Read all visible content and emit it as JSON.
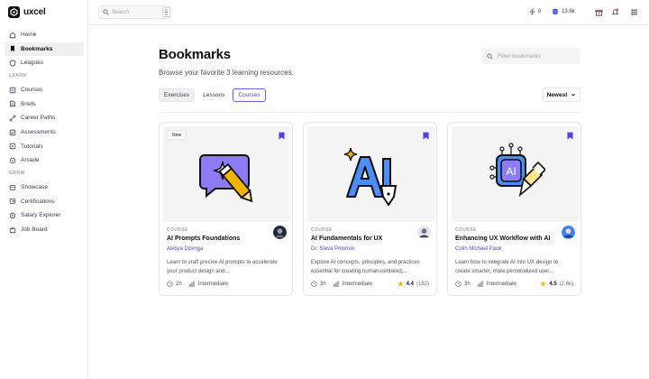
{
  "app": {
    "name": "uxcel"
  },
  "sidebar": {
    "items": [
      {
        "label": "Home",
        "icon": "home-icon"
      },
      {
        "label": "Bookmarks",
        "icon": "bookmark-icon",
        "active": true
      },
      {
        "label": "Leagues",
        "icon": "shield-icon"
      }
    ],
    "learn_title": "LEARN",
    "learn_items": [
      {
        "label": "Courses",
        "icon": "courses-icon"
      },
      {
        "label": "Briefs",
        "icon": "briefs-icon"
      },
      {
        "label": "Career Paths",
        "icon": "career-paths-icon"
      },
      {
        "label": "Assessments",
        "icon": "assessments-icon"
      },
      {
        "label": "Tutorials",
        "icon": "tutorials-icon"
      },
      {
        "label": "Arcade",
        "icon": "arcade-icon"
      }
    ],
    "grow_title": "GROW",
    "grow_items": [
      {
        "label": "Showcase",
        "icon": "showcase-icon"
      },
      {
        "label": "Certifications",
        "icon": "certifications-icon"
      },
      {
        "label": "Salary Explorer",
        "icon": "salary-explorer-icon"
      },
      {
        "label": "Job Board",
        "icon": "job-board-icon"
      }
    ]
  },
  "header": {
    "search_placeholder": "Search",
    "streak": "0",
    "xp": "13.6k",
    "avatar_initial": "E"
  },
  "main": {
    "title": "Bookmarks",
    "subtitle": "Browse your favorite 3 learning resources.",
    "filter_placeholder": "Filter bookmarks",
    "tabs": [
      "Exercises",
      "Lessons",
      "Courses"
    ],
    "sort_label": "Newest"
  },
  "cards": [
    {
      "badge": "New",
      "type": "COURSE",
      "title": "AI Prompts Foundations",
      "author": "Alesya Dzenga",
      "description": "Learn to craft precise AI prompts to accelerate your product design and...",
      "duration": "2h",
      "level": "Intermediate"
    },
    {
      "type": "COURSE",
      "title": "AI Fundamentals for UX",
      "author": "Dr. Slava Polonski",
      "description": "Explore AI concepts, principles, and practices essential for creating human-centered,...",
      "duration": "3h",
      "level": "Intermediate",
      "rating": "4.4",
      "reviews": "(182)"
    },
    {
      "type": "COURSE",
      "title": "Enhancing UX Workflow with AI",
      "author": "Colin Michael Pace",
      "description": "Learn how to integrate AI into UX design to create smarter, more personalized user...",
      "duration": "3h",
      "level": "Intermediate",
      "rating": "4.5",
      "reviews": "(2.6k)"
    }
  ],
  "colors": {
    "accent": "#4f46e5",
    "illustration_purple": "#8b7cf6",
    "illustration_blue": "#4c8df6",
    "star": "#f5b301"
  }
}
